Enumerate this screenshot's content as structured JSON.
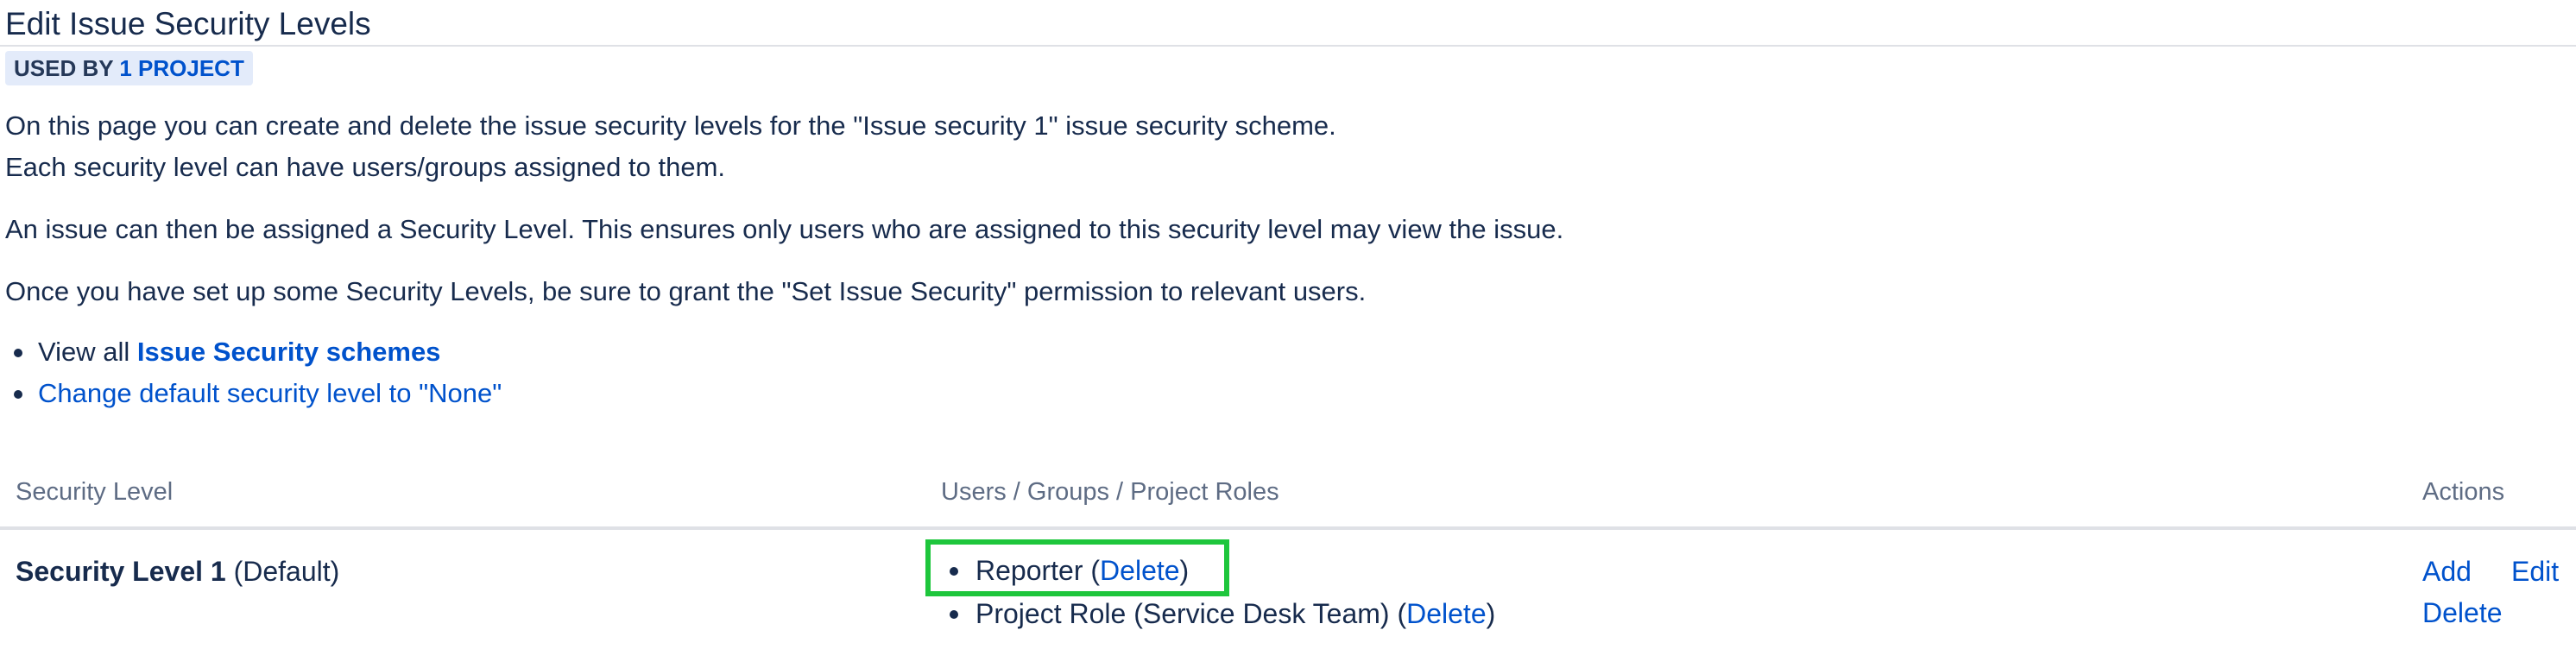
{
  "page": {
    "title": "Edit Issue Security Levels",
    "badge": {
      "prefix": "USED BY",
      "link": "1 PROJECT"
    },
    "intro_line_1": "On this page you can create and delete the issue security levels for the \"Issue security 1\" issue security scheme.",
    "intro_line_2": "Each security level can have users/groups assigned to them.",
    "intro_line_3": "An issue can then be assigned a Security Level. This ensures only users who are assigned to this security level may view the issue.",
    "intro_line_4": "Once you have set up some Security Levels, be sure to grant the \"Set Issue Security\" permission to relevant users."
  },
  "links": {
    "view_all_prefix": "View all",
    "view_all_link": "Issue Security schemes",
    "change_default": "Change default security level to \"None\""
  },
  "table": {
    "headers": {
      "level": "Security Level",
      "members": "Users / Groups / Project Roles",
      "actions": "Actions"
    },
    "rows": [
      {
        "name": "Security Level 1",
        "default_label": "(Default)",
        "members": [
          {
            "label": "Reporter",
            "delete": "Delete",
            "highlighted": true
          },
          {
            "label": "Project Role (Service Desk Team)",
            "delete": "Delete",
            "highlighted": false
          }
        ],
        "actions": {
          "add": "Add",
          "edit": "Edit",
          "delete": "Delete"
        }
      }
    ]
  },
  "colors": {
    "link": "#0052cc",
    "text": "#172b4d",
    "muted_header": "#5e6c84",
    "badge_bg": "#e3ebfa",
    "highlight": "#1ec63c"
  }
}
